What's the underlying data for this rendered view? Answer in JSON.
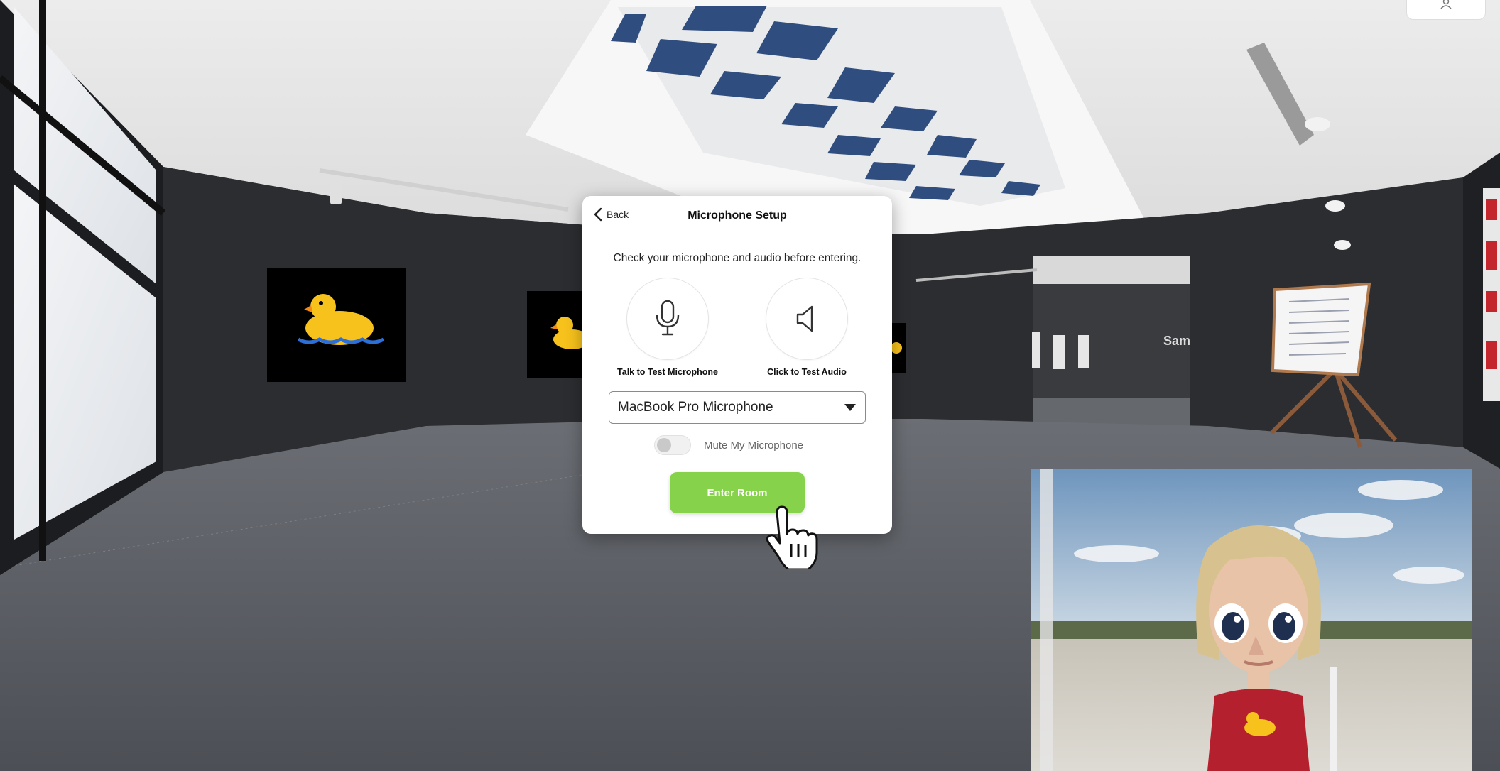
{
  "modal": {
    "back_label": "Back",
    "title": "Microphone Setup",
    "description": "Check your microphone and audio before entering.",
    "mic_test_label": "Talk to Test Microphone",
    "audio_test_label": "Click to Test Audio",
    "mic_select": {
      "value": "MacBook Pro Microphone"
    },
    "mute_label": "Mute My Microphone",
    "mute_enabled": false,
    "enter_label": "Enter Room"
  },
  "colors": {
    "enter_button": "#86d24a",
    "modal_bg": "#ffffff",
    "wall": "#2c2d30",
    "floor": "#5a5d63"
  },
  "icons": [
    "back-chevron-icon",
    "microphone-icon",
    "speaker-icon",
    "dropdown-arrow-icon",
    "hand-cursor-icon"
  ]
}
